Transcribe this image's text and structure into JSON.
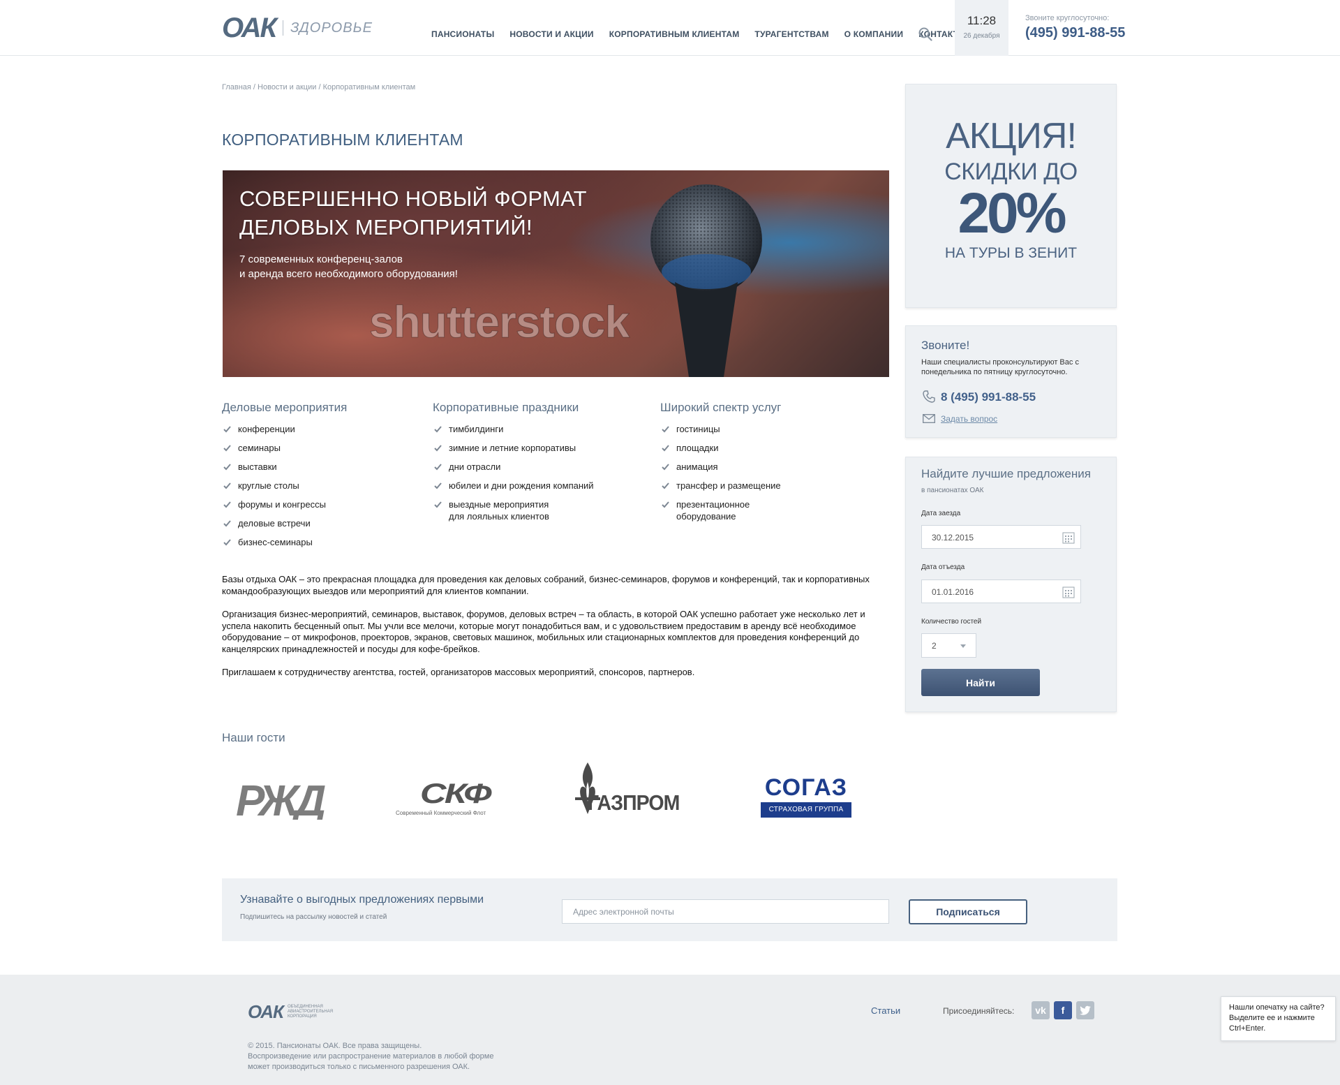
{
  "header": {
    "logo_text": "ОАК",
    "logo_sub": "ЗДОРОВЬЕ",
    "nav": [
      "ПАНСИОНАТЫ",
      "НОВОСТИ И АКЦИИ",
      "КОРПОРАТИВНЫМ КЛИЕНТАМ",
      "ТУРАГЕНТСТВАМ",
      "О КОМПАНИИ",
      "КОНТАКТЫ"
    ],
    "time": "11:28",
    "date": "26 декабря",
    "call_label": "Звоните круглосуточно:",
    "phone": "(495) 991-88-55"
  },
  "breadcrumb": "Главная / Новости и акции / Корпоративным клиентам",
  "page_title": "КОРПОРАТИВНЫМ КЛИЕНТАМ",
  "banner": {
    "headline_1": "СОВЕРШЕННО НОВЫЙ ФОРМАТ",
    "headline_2": "ДЕЛОВЫХ МЕРОПРИЯТИЙ!",
    "subtext_1": "7 современных конференц-залов",
    "subtext_2": "и аренда всего необходимого оборудования!",
    "watermark": "shutterstock"
  },
  "columns": [
    {
      "title": "Деловые мероприятия",
      "items": [
        "конференции",
        "семинары",
        "выставки",
        "круглые столы",
        "форумы и конгрессы",
        "деловые встречи",
        "бизнес-семинары"
      ]
    },
    {
      "title": "Корпоративные праздники",
      "items": [
        "тимбилдинги",
        "зимние и летние корпоративы",
        "дни отрасли",
        "юбилеи и дни рождения компаний",
        "выездные мероприятия\nдля лояльных клиентов"
      ]
    },
    {
      "title": "Широкий спектр услуг",
      "items": [
        "гостиницы",
        "площадки",
        "анимация",
        "трансфер и размещение",
        "презентационное\nоборудование"
      ]
    }
  ],
  "paragraphs": [
    "Базы отдыха ОАК – это прекрасная площадка для проведения как деловых собраний, бизнес-семинаров, форумов и конференций, так и корпоративных командообразующих выездов или мероприятий для клиентов компании.",
    "Организация бизнес-мероприятий, семинаров, выставок, форумов, деловых встреч – та область, в которой ОАК успешно работает уже несколько лет и успела накопить бесценный опыт. Мы учли все мелочи, которые могут понадобиться вам, и с удовольствием предоставим в аренду всё необходимое оборудование – от микрофонов, проекторов, экранов, световых машинок, мобильных или стационарных комплектов для проведения конференций до канцелярских принадлежностей и посуды для кофе-брейков.",
    "Приглашаем к сотрудничеству агентства, гостей, организаторов массовых мероприятий, спонсоров, партнеров."
  ],
  "guests": {
    "title": "Наши гости",
    "rzd": "РЖД",
    "skf": "СКФ",
    "skf_sub": "Современный Коммерческий Флот",
    "gazprom": "ГАЗПРОМ",
    "sogaz": "СОГАЗ",
    "sogaz_sub": "СТРАХОВАЯ ГРУППА"
  },
  "subscribe": {
    "title": "Узнавайте о выгодных предложениях первыми",
    "subtitle": "Подпишитесь на рассылку новостей и статей",
    "placeholder": "Адрес электронной почты",
    "button": "Подписаться"
  },
  "promo": {
    "line1": "АКЦИЯ!",
    "line2": "СКИДКИ ДО",
    "line3": "20%",
    "line4": "НА ТУРЫ В ЗЕНИТ"
  },
  "call_box": {
    "title": "Звоните!",
    "text": "Наши специалисты проконсультируют Вас с понедельника по пятницу круглосуточно.",
    "phone": "8 (495) 991-88-55",
    "ask": "Задать вопрос"
  },
  "find_box": {
    "title": "Найдите лучшие предложения",
    "subtitle": "в пансионатах ОАК",
    "checkin_label": "Дата заезда",
    "checkin_value": "30.12.2015",
    "checkout_label": "Дата отъезда",
    "checkout_value": "01.01.2016",
    "guests_label": "Количество гостей",
    "guests_value": "2",
    "button": "Найти"
  },
  "footer": {
    "logo_text": "ОАК",
    "logo_caption": "ОБЪЕДИНЕННАЯ АВИАСТРОИТЕЛЬНАЯ КОРПОРАЦИЯ",
    "articles": "Статьи",
    "join": "Присоединяйтесь:",
    "copy_1": "© 2015. Пансионаты ОАК. Все права защищены.",
    "copy_2": "Воспроизведение или распространение материалов в любой форме",
    "copy_3": "может производиться только с письменного разрешения ОАК."
  },
  "typo": {
    "line1": "Нашли опечатку на сайте?",
    "line2": "Выделите ее и нажмите",
    "line3": "Ctrl+Enter."
  },
  "colors": {
    "accent": "#3d5779",
    "panel": "#eef1f4",
    "link": "#3d5f8a"
  }
}
